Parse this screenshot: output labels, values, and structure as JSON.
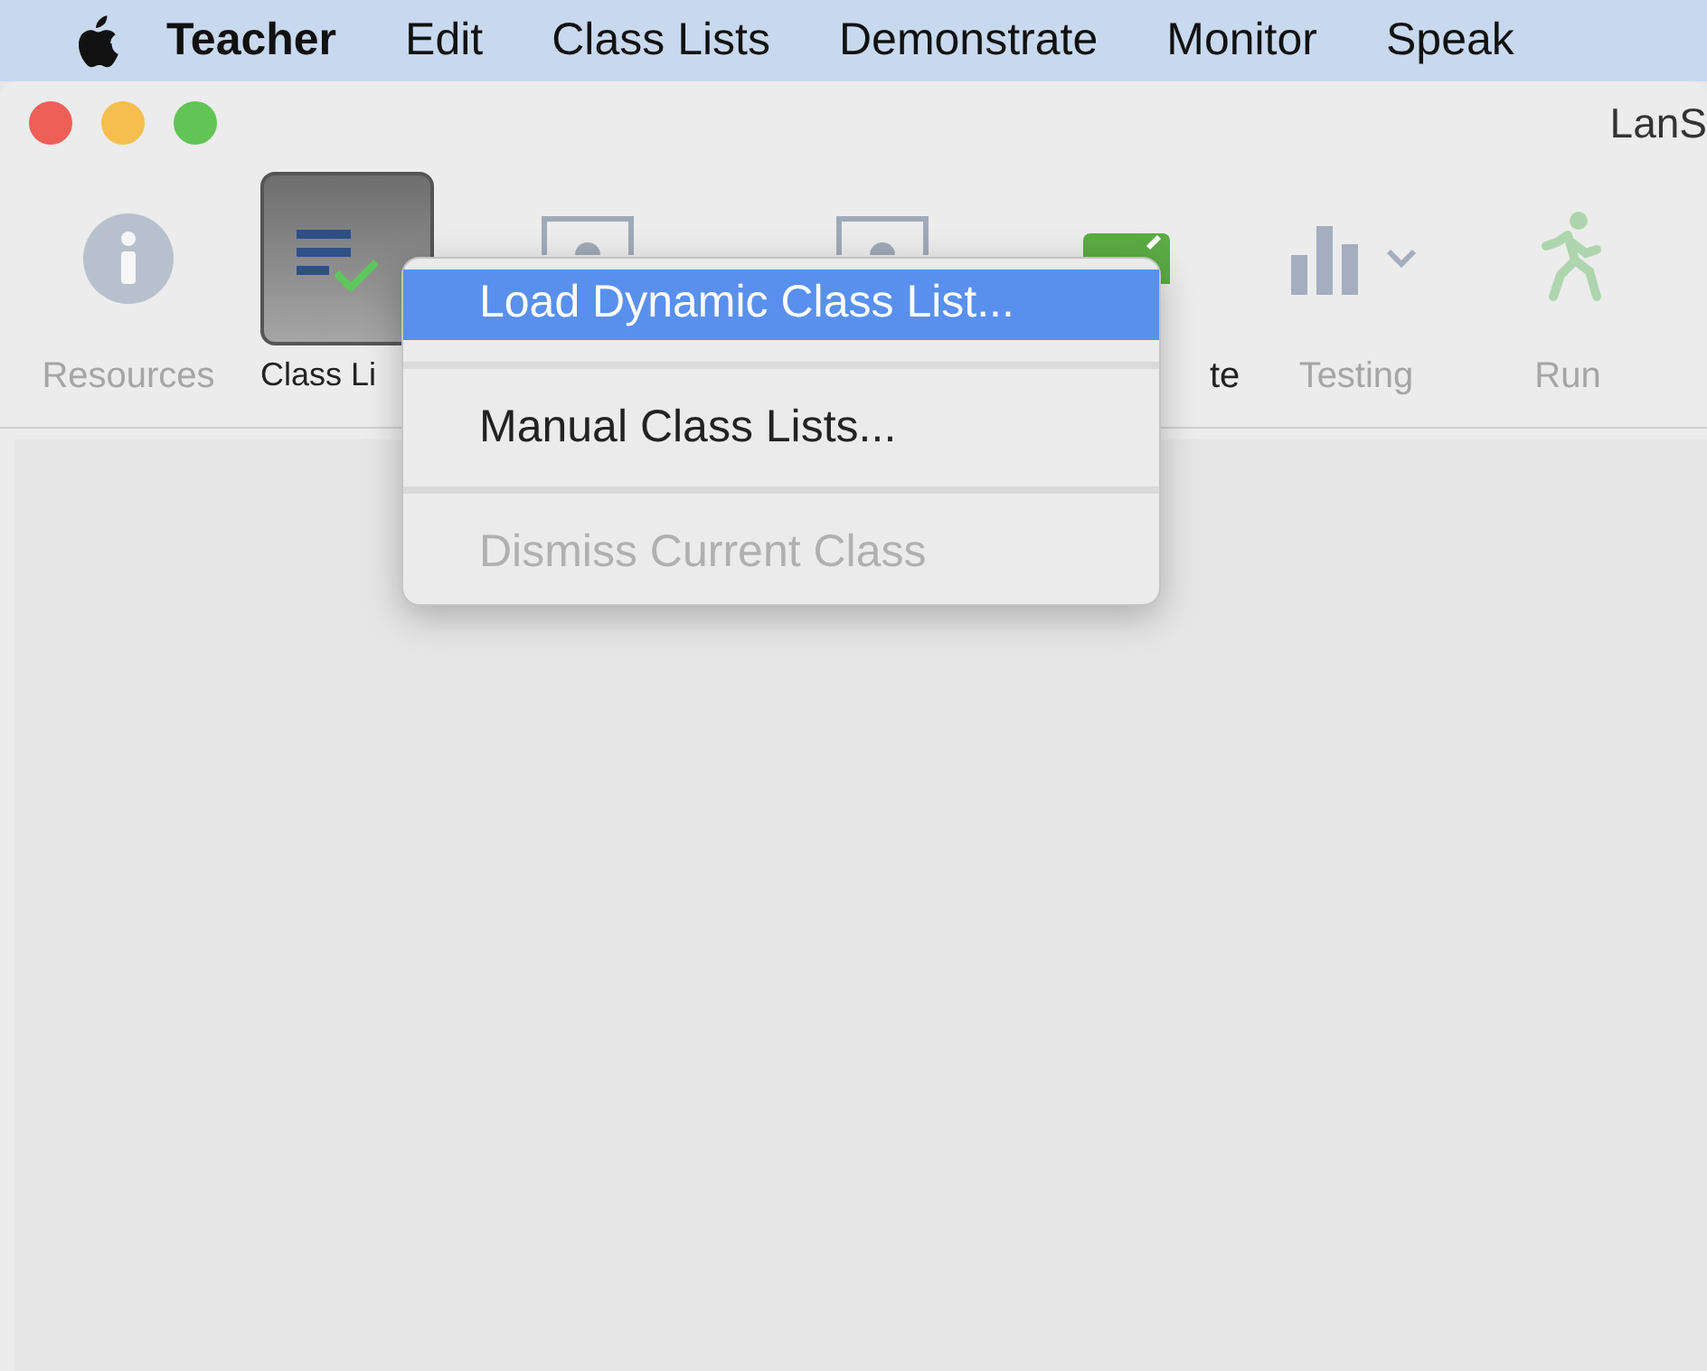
{
  "menu_bar": {
    "items": [
      {
        "label": "Teacher",
        "kind": "app"
      },
      {
        "label": "Edit",
        "kind": "menu"
      },
      {
        "label": "Class Lists",
        "kind": "menu"
      },
      {
        "label": "Demonstrate",
        "kind": "menu"
      },
      {
        "label": "Monitor",
        "kind": "menu"
      },
      {
        "label": "Speak",
        "kind": "menu"
      }
    ]
  },
  "window": {
    "title": "LanS"
  },
  "toolbar": [
    {
      "kind": "info",
      "label": "Resources",
      "disabled": true,
      "selected": false
    },
    {
      "kind": "classlist",
      "label": "Class Li",
      "disabled": false,
      "selected": true
    },
    {
      "kind": "frame"
    },
    {
      "kind": "frame"
    },
    {
      "kind": "green",
      "label": "te",
      "disabled": false,
      "selected": false
    },
    {
      "kind": "chart",
      "label": "Testing",
      "disabled": true,
      "selected": false
    },
    {
      "kind": "runner",
      "label": "Run",
      "disabled": true,
      "selected": false
    }
  ],
  "dropdown_menu": {
    "items": [
      {
        "label": "Load Dynamic Class List...",
        "selected": true,
        "disabled": false
      },
      {
        "label": "Manual Class Lists...",
        "selected": false,
        "disabled": false
      },
      {
        "label": "Dismiss Current Class",
        "selected": false,
        "disabled": true
      }
    ]
  }
}
